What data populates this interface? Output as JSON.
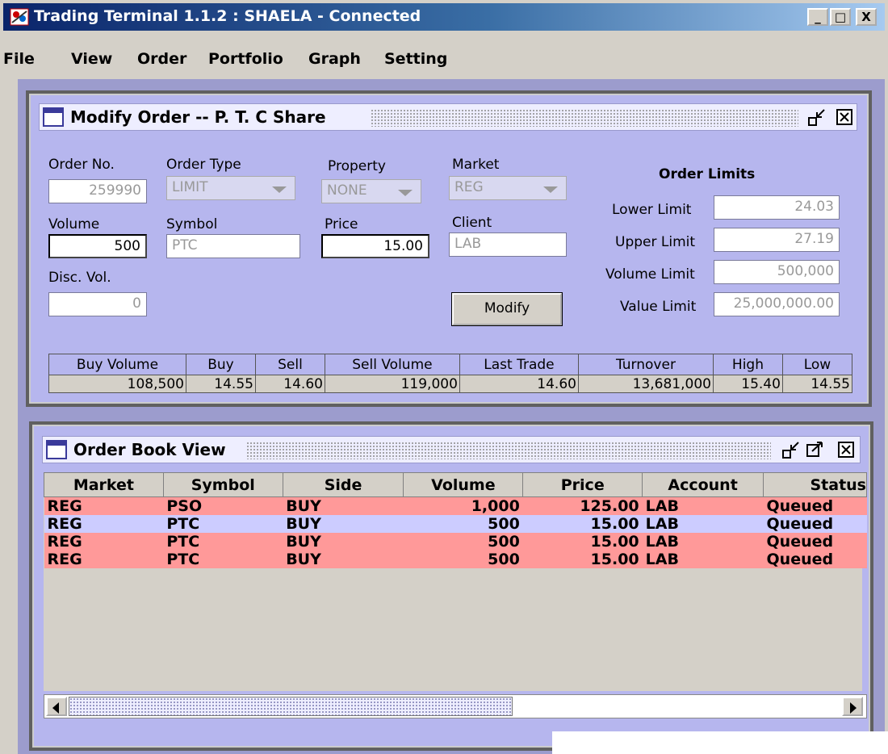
{
  "window": {
    "title": "Trading Terminal 1.1.2 : SHAELA - Connected",
    "controls": {
      "minimize": "_",
      "maximize": "□",
      "close": "X"
    }
  },
  "menu": [
    "File",
    "View",
    "Order",
    "Portfolio",
    "Graph",
    "Setting"
  ],
  "modify_order": {
    "title": "Modify Order -- P. T. C Share",
    "labels": {
      "order_no": "Order No.",
      "order_type": "Order Type",
      "property": "Property",
      "market": "Market",
      "volume": "Volume",
      "symbol": "Symbol",
      "price": "Price",
      "client": "Client",
      "disc_vol": "Disc. Vol."
    },
    "values": {
      "order_no": "259990",
      "order_type": "LIMIT",
      "property": "NONE",
      "market": "REG",
      "volume": "500",
      "symbol": "PTC",
      "price": "15.00",
      "client": "LAB",
      "disc_vol": "0"
    },
    "modify_button": "Modify",
    "limits": {
      "title": "Order Limits",
      "lower_label": "Lower Limit",
      "lower": "24.03",
      "upper_label": "Upper Limit",
      "upper": "27.19",
      "volume_label": "Volume Limit",
      "volume": "500,000",
      "value_label": "Value Limit",
      "value": "25,000,000.00"
    },
    "quote_headers": [
      "Buy Volume",
      "Buy",
      "Sell",
      "Sell Volume",
      "Last Trade",
      "Turnover",
      "High",
      "Low"
    ],
    "quote_values": [
      "108,500",
      "14.55",
      "14.60",
      "119,000",
      "14.60",
      "13,681,000",
      "15.40",
      "14.55"
    ]
  },
  "order_book": {
    "title": "Order Book View",
    "headers": [
      "Market",
      "Symbol",
      "Side",
      "Volume",
      "Price",
      "Account",
      "Status"
    ],
    "rows": [
      [
        "REG",
        "PSO",
        "BUY",
        "1,000",
        "125.00",
        "LAB",
        "Queued"
      ],
      [
        "REG",
        "PTC",
        "BUY",
        "500",
        "15.00",
        "LAB",
        "Queued"
      ],
      [
        "REG",
        "PTC",
        "BUY",
        "500",
        "15.00",
        "LAB",
        "Queued"
      ],
      [
        "REG",
        "PTC",
        "BUY",
        "500",
        "15.00",
        "LAB",
        "Queued"
      ]
    ],
    "row_colors": [
      "#ff9999",
      "#ccccff",
      "#ff9999",
      "#ff9999"
    ]
  },
  "icons": {
    "app": "app-logo-icon",
    "frame": "window-icon",
    "minimize_frame": "minimize-frame-icon",
    "maximize_frame": "maximize-frame-icon",
    "close_frame": "close-frame-icon"
  }
}
